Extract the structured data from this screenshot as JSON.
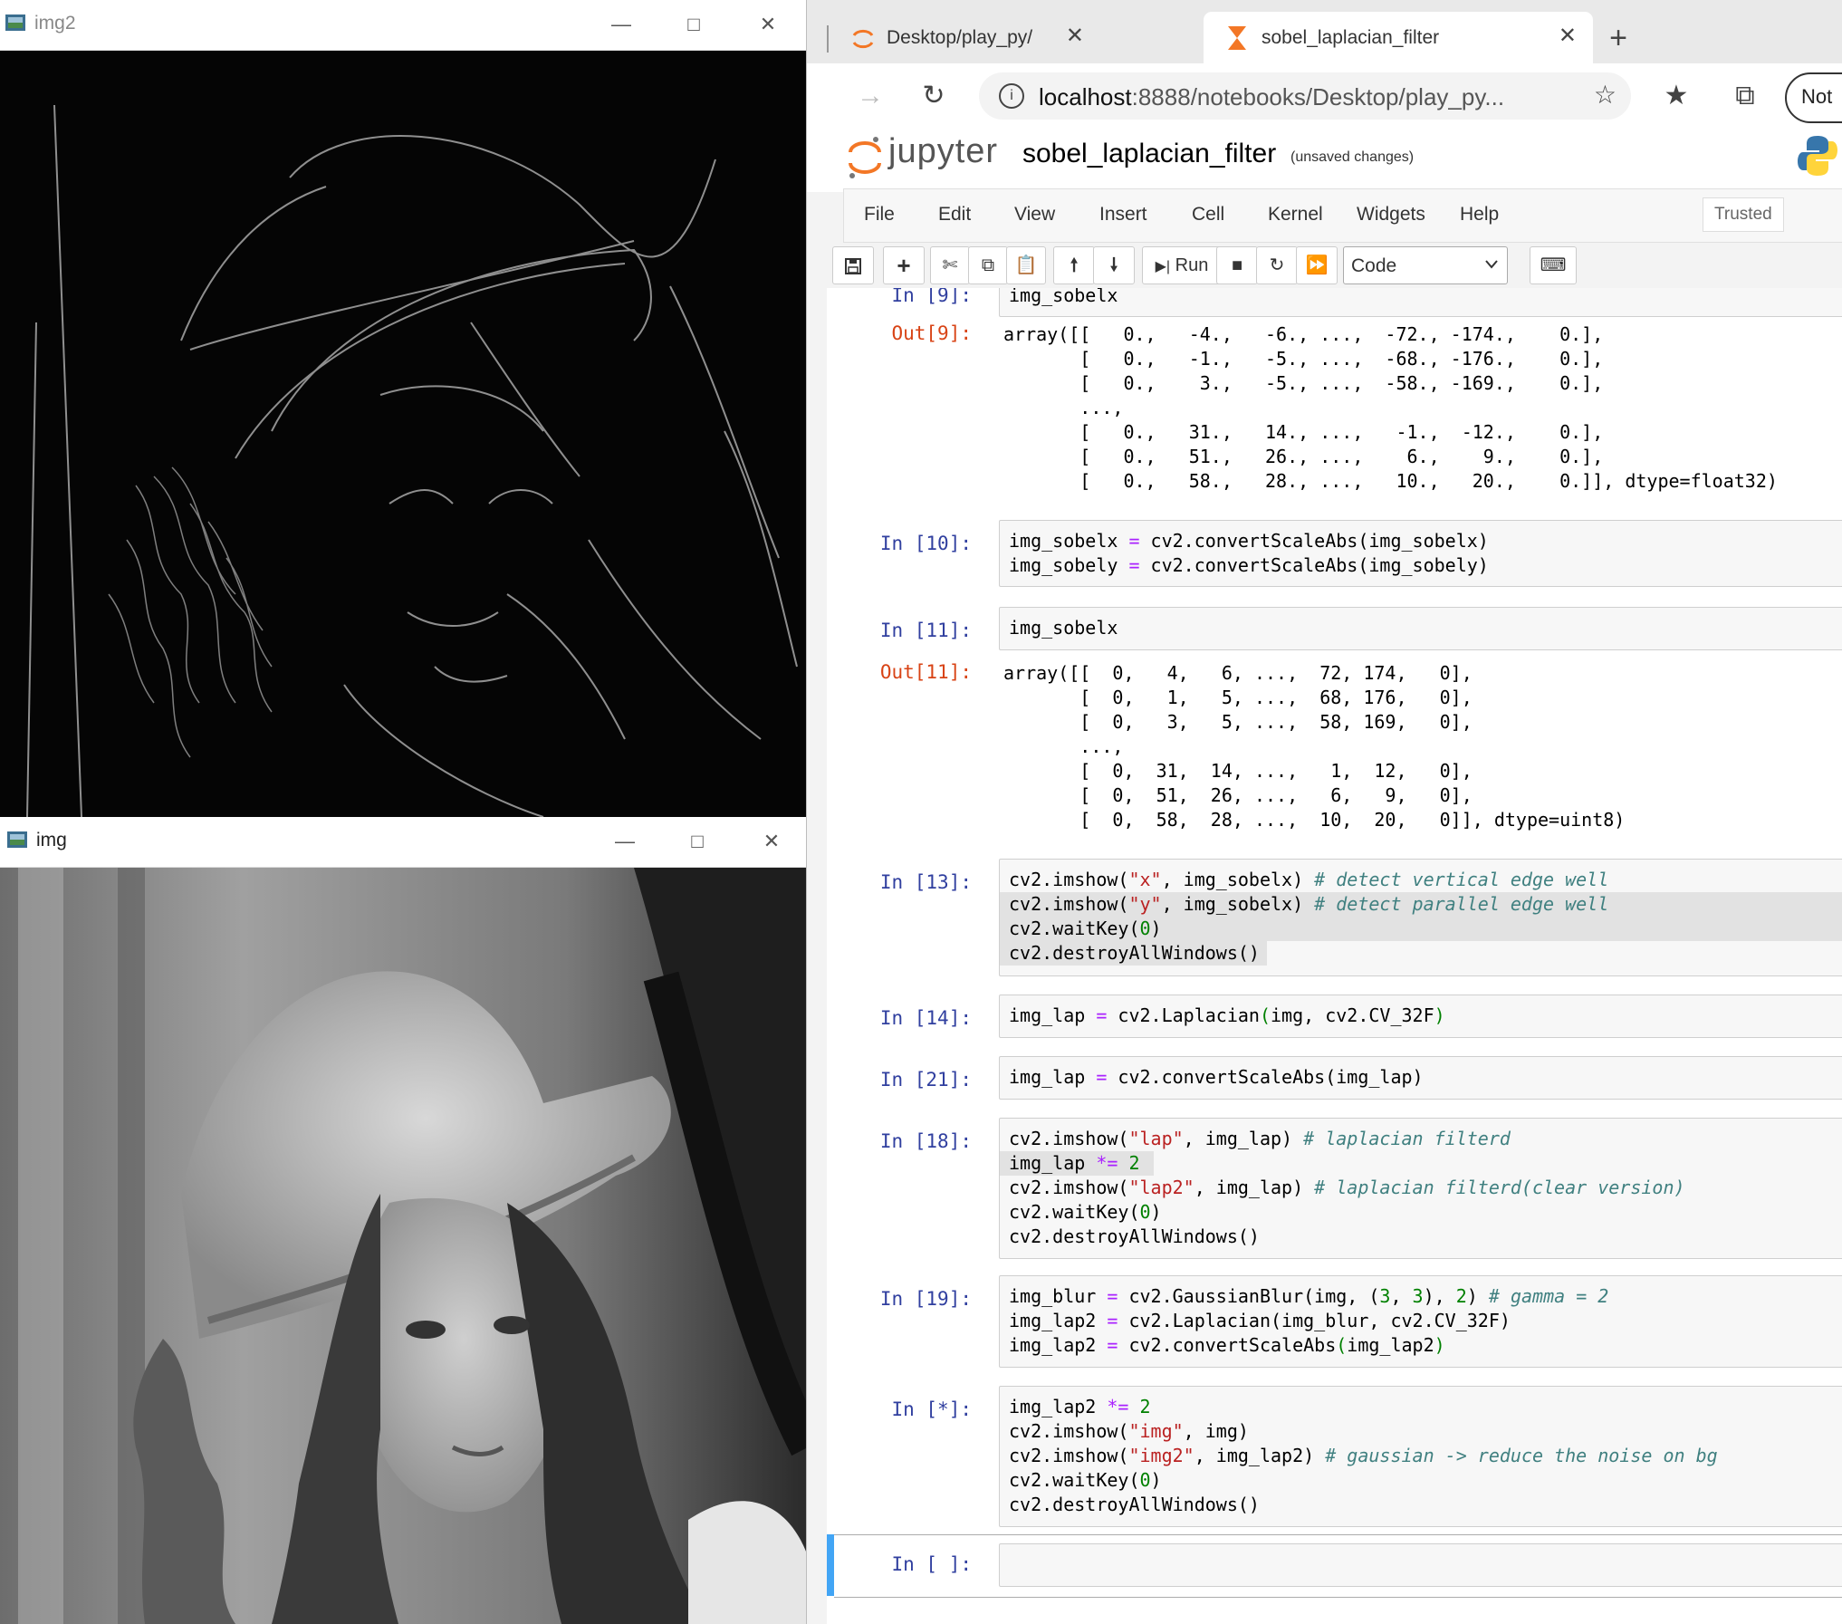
{
  "windows": {
    "top": {
      "title": "img2"
    },
    "bottom": {
      "title": "img"
    }
  },
  "browser": {
    "tabs": [
      {
        "label": "Desktop/play_py/"
      },
      {
        "label": "sobel_laplacian_filter"
      }
    ],
    "address": {
      "host": "localhost",
      "rest": ":8888/notebooks/Desktop/play_py..."
    },
    "profile_button": "Not"
  },
  "jupyter": {
    "logo_text": "jupyter",
    "notebook_name": "sobel_laplacian_filter",
    "save_status": "(unsaved changes)",
    "menu": [
      "File",
      "Edit",
      "View",
      "Insert",
      "Cell",
      "Kernel",
      "Widgets",
      "Help"
    ],
    "trusted": "Trusted",
    "run_label": "Run",
    "cell_type": "Code"
  },
  "cells": [
    {
      "prompt": "In [9]:",
      "code": "img_sobelx"
    },
    {
      "prompt": "Out[9]:",
      "code": "array([[   0.,   -4.,   -6., ...,  -72., -174.,    0.],\n       [   0.,   -1.,   -5., ...,  -68., -176.,    0.],\n       [   0.,    3.,   -5., ...,  -58., -169.,    0.],\n       ...,\n       [   0.,   31.,   14., ...,   -1.,  -12.,    0.],\n       [   0.,   51.,   26., ...,    6.,    9.,    0.],\n       [   0.,   58.,   28., ...,   10.,   20.,    0.]], dtype=float32)"
    },
    {
      "prompt": "In [10]:",
      "code": "img_sobelx = cv2.convertScaleAbs(img_sobelx)\nimg_sobely = cv2.convertScaleAbs(img_sobely)"
    },
    {
      "prompt": "In [11]:",
      "code": "img_sobelx"
    },
    {
      "prompt": "Out[11]:",
      "code": "array([[  0,   4,   6, ...,  72, 174,   0],\n       [  0,   1,   5, ...,  68, 176,   0],\n       [  0,   3,   5, ...,  58, 169,   0],\n       ...,\n       [  0,  31,  14, ...,   1,  12,   0],\n       [  0,  51,  26, ...,   6,   9,   0],\n       [  0,  58,  28, ...,  10,  20,   0]], dtype=uint8)"
    },
    {
      "prompt": "In [13]:",
      "code": "cv2.imshow(\"x\", img_sobelx) # detect vertical edge well\ncv2.imshow(\"y\", img_sobelx) # detect parallel edge well\ncv2.waitKey(0)\ncv2.destroyAllWindows()"
    },
    {
      "prompt": "In [14]:",
      "code": "img_lap = cv2.Laplacian(img, cv2.CV_32F)"
    },
    {
      "prompt": "In [21]:",
      "code": "img_lap = cv2.convertScaleAbs(img_lap)"
    },
    {
      "prompt": "In [18]:",
      "code": "cv2.imshow(\"lap\", img_lap) # laplacian filterd\nimg_lap *= 2\ncv2.imshow(\"lap2\", img_lap) # laplacian filterd(clear version)\ncv2.waitKey(0)\ncv2.destroyAllWindows()"
    },
    {
      "prompt": "In [19]:",
      "code": "img_blur = cv2.GaussianBlur(img, (3, 3), 2) # gamma = 2\nimg_lap2 = cv2.Laplacian(img_blur, cv2.CV_32F)\nimg_lap2 = cv2.convertScaleAbs(img_lap2)"
    },
    {
      "prompt": "In [*]:",
      "code": "img_lap2 *= 2\ncv2.imshow(\"img\", img)\ncv2.imshow(\"img2\", img_lap2) # gaussian -> reduce the noise on bg\ncv2.waitKey(0)\ncv2.destroyAllWindows()"
    },
    {
      "prompt": "In [ ]:",
      "code": ""
    }
  ],
  "colors": {
    "in_prompt": "#303f9f",
    "out_prompt": "#d84315",
    "active_cell_bar": "#42a5f5"
  }
}
